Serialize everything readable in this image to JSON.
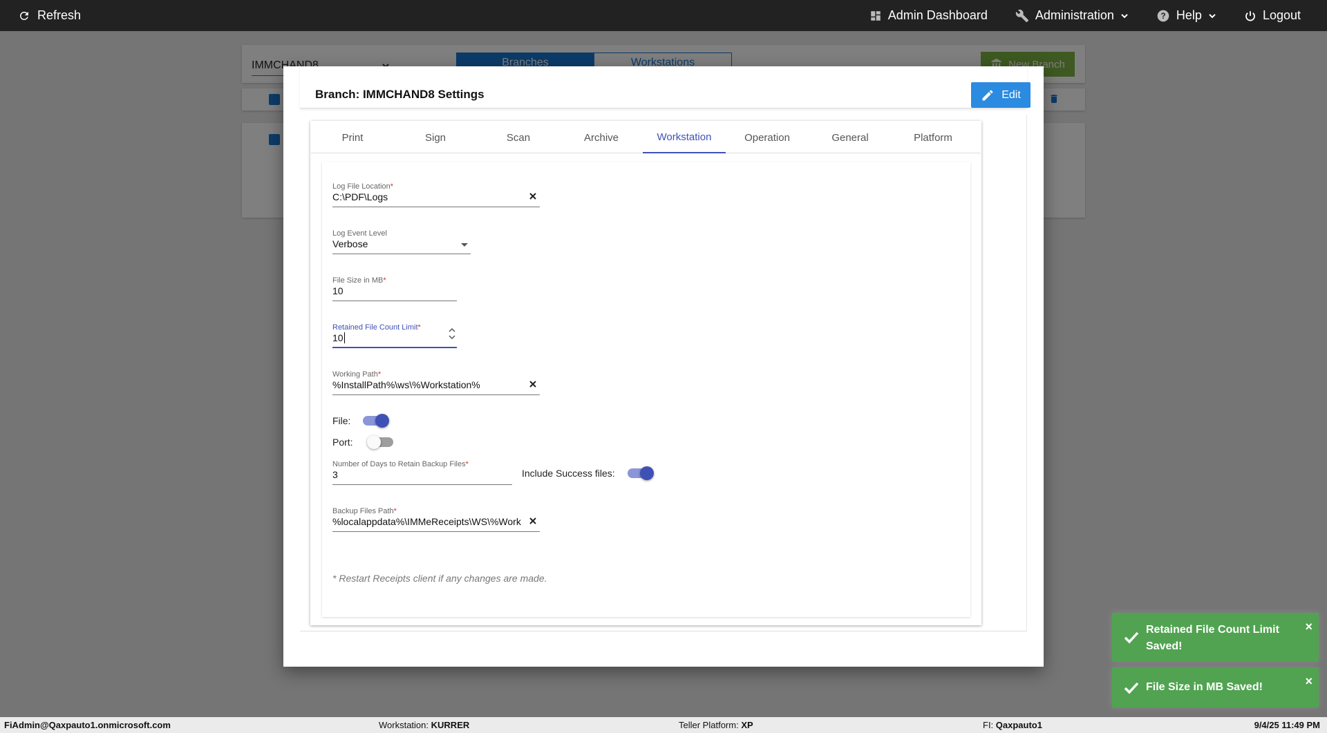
{
  "topbar": {
    "refresh_label": "Refresh",
    "admin_dashboard_label": "Admin Dashboard",
    "administration_label": "Administration",
    "help_label": "Help",
    "logout_label": "Logout"
  },
  "background": {
    "branch_select_value": "IMMCHAND8",
    "segment_branches": "Branches",
    "segment_workstations": "Workstations",
    "new_branch_label": "New Branch"
  },
  "modal": {
    "title": "Branch: IMMCHAND8 Settings",
    "edit_label": "Edit",
    "tabs": [
      {
        "label": "Print"
      },
      {
        "label": "Sign"
      },
      {
        "label": "Scan"
      },
      {
        "label": "Archive"
      },
      {
        "label": "Workstation"
      },
      {
        "label": "Operation"
      },
      {
        "label": "General"
      },
      {
        "label": "Platform"
      }
    ],
    "active_tab": "Workstation",
    "fields": {
      "log_file_location": {
        "label": "Log File Location",
        "value": "C:\\PDF\\Logs"
      },
      "log_event_level": {
        "label": "Log Event Level",
        "value": "Verbose"
      },
      "file_size": {
        "label": "File Size in MB",
        "value": "10"
      },
      "retained_count": {
        "label": "Retained File Count Limit",
        "value": "10"
      },
      "working_path": {
        "label": "Working Path",
        "value": "%InstallPath%\\ws\\%Workstation%"
      },
      "retain_days": {
        "label": "Number of Days to Retain Backup Files",
        "value": "3"
      },
      "backup_path": {
        "label": "Backup Files Path",
        "value": "%localappdata%\\IMMeReceipts\\WS\\%Work"
      }
    },
    "required_marker": "*",
    "toggles": {
      "file": {
        "label": "File:",
        "on": true
      },
      "port": {
        "label": "Port:",
        "on": false
      },
      "include_success": {
        "label": "Include Success files:",
        "on": true
      }
    },
    "note": "* Restart Receipts client if any changes are made."
  },
  "toasts": [
    {
      "line1": "Retained File Count Limit",
      "line2": "Saved!"
    },
    {
      "line1": "File Size in MB Saved!"
    }
  ],
  "footer": {
    "user": "FiAdmin@Qaxpauto1.onmicrosoft.com",
    "workstation_label": "Workstation:",
    "workstation_value": "KURRER",
    "platform_label": "Teller Platform:",
    "platform_value": "XP",
    "fi_label": "FI:",
    "fi_value": "Qaxpauto1",
    "datetime": "9/4/25 11:49 PM"
  },
  "colors": {
    "accent": "#3f51b5",
    "edit_button": "#2a8be0",
    "toast_success": "#51a351",
    "new_branch": "#7cb342",
    "topbar": "#222222"
  }
}
